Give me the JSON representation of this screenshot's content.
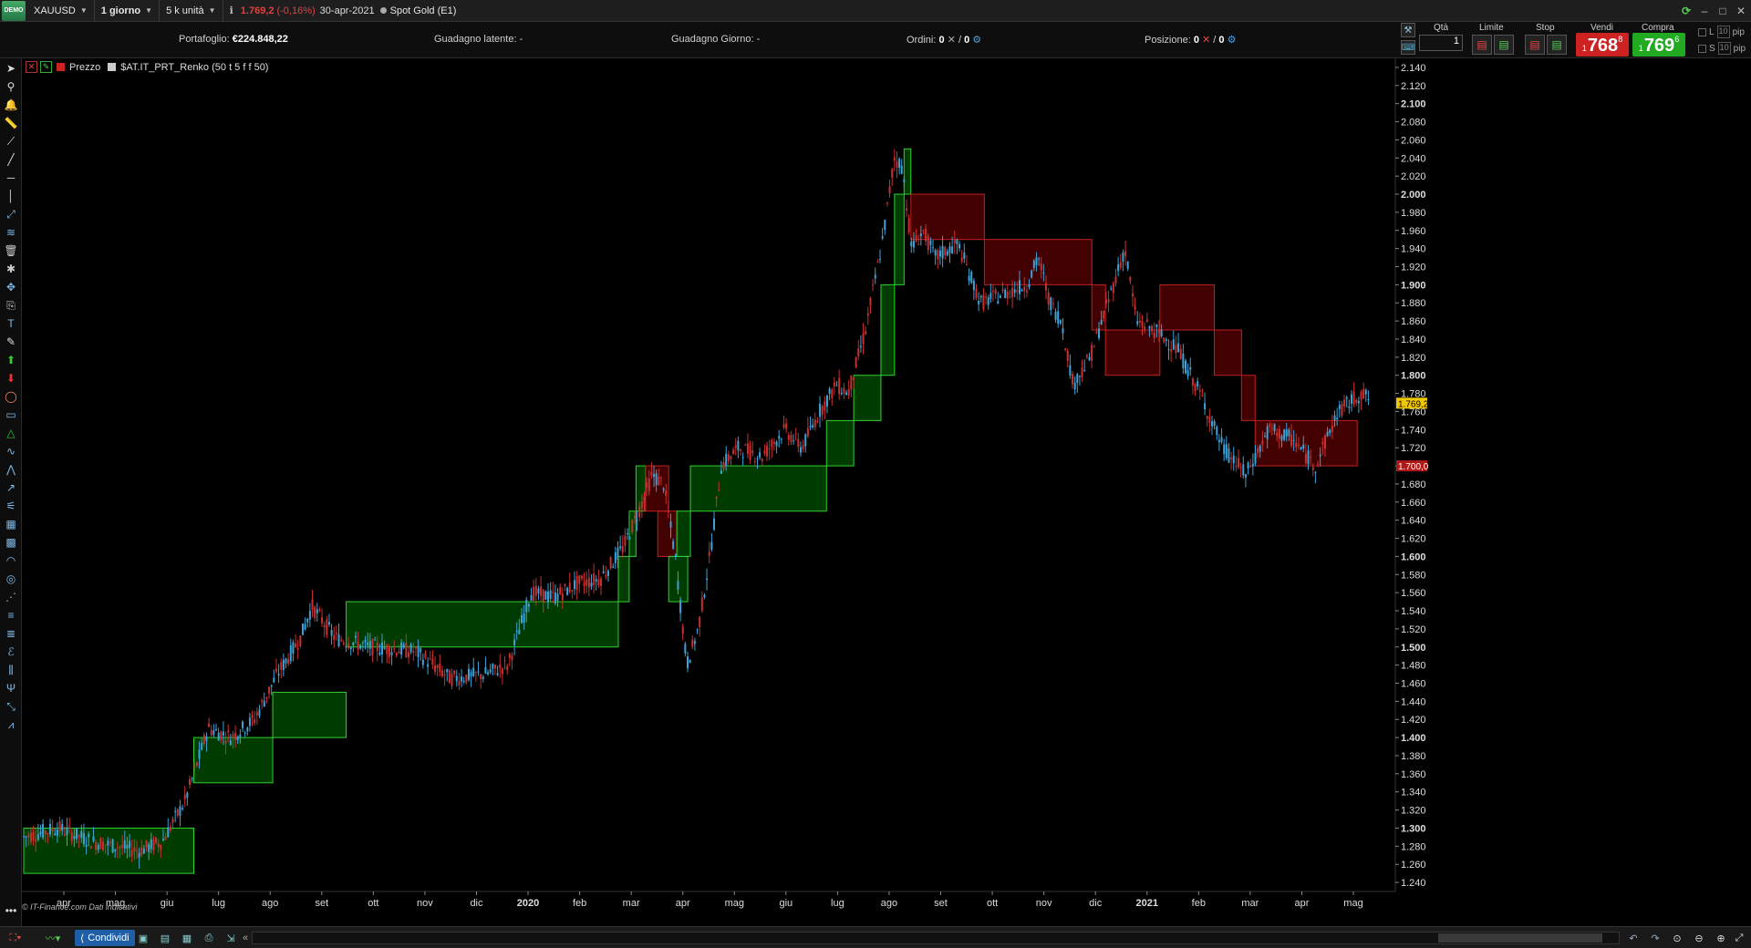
{
  "title_bar": {
    "badge": "DEMO",
    "symbol": "XAUUSD",
    "timeframe": "1 giorno",
    "units": "5 k unità",
    "last_price": "1.769,2",
    "change": "(-0,16%)",
    "date": "30-apr-2021",
    "instrument": "Spot Gold (E1)"
  },
  "account": {
    "portfolio_label": "Portafoglio:",
    "portfolio_value": "€224.848,22",
    "latent_label": "Guadagno latente:",
    "latent_value": "-",
    "day_label": "Guadagno Giorno:",
    "day_value": "-",
    "orders_label": "Ordini:",
    "orders_a": "0",
    "orders_sep": "/",
    "orders_b": "0",
    "position_label": "Posizione:",
    "position_a": "0",
    "position_sep": "/",
    "position_b": "0"
  },
  "order_panel": {
    "qty_label": "Qtà",
    "qty_value": "1",
    "limit_label": "Limite",
    "stop_label": "Stop",
    "sell_label": "Vendi",
    "buy_label": "Compra",
    "sell_prefix": "1",
    "sell_big": "768",
    "sell_sup": "8",
    "buy_prefix": "1",
    "buy_big": "769",
    "buy_sup": "6",
    "l_label": "L",
    "s_label": "S",
    "l_pip_value": "10",
    "s_pip_value": "10",
    "pip_label": "pip"
  },
  "legend": {
    "price_label": "Prezzo",
    "indicator_label": "$AT.IT_PRT_Renko (50 t 5 f f 50)"
  },
  "watermark": "© IT-Finance.com  Dati indicativi",
  "bottom_bar": {
    "share_label": "Condividi"
  },
  "chart_data": {
    "type": "candlestick",
    "instrument": "XAUUSD",
    "y_axis": {
      "range": [
        1230,
        2150
      ],
      "tick_labels": [
        "2.140",
        "2.120",
        "2.100",
        "2.080",
        "2.060",
        "2.040",
        "2.020",
        "2.000",
        "1.980",
        "1.960",
        "1.940",
        "1.920",
        "1.900",
        "1.880",
        "1.860",
        "1.840",
        "1.820",
        "1.800",
        "1.780",
        "1.760",
        "1.740",
        "1.720",
        "1.700",
        "1.680",
        "1.660",
        "1.640",
        "1.620",
        "1.600",
        "1.580",
        "1.560",
        "1.540",
        "1.520",
        "1.500",
        "1.480",
        "1.460",
        "1.440",
        "1.420",
        "1.400",
        "1.380",
        "1.360",
        "1.340",
        "1.320",
        "1.300",
        "1.280",
        "1.260",
        "1.240"
      ],
      "bold_labels": [
        "2.100",
        "2.000",
        "1.900",
        "1.800",
        "1.600",
        "1.500",
        "1.400",
        "1.300"
      ],
      "price_marker": "1.769,2",
      "secondary_marker": "1.700,0"
    },
    "x_axis": {
      "labels": [
        "apr",
        "mag",
        "giu",
        "lug",
        "ago",
        "set",
        "ott",
        "nov",
        "dic",
        "2020",
        "feb",
        "mar",
        "apr",
        "mag",
        "giu",
        "lug",
        "ago",
        "set",
        "ott",
        "nov",
        "dic",
        "2021",
        "feb",
        "mar",
        "apr",
        "mag"
      ],
      "bold_labels": [
        "2020",
        "2021"
      ]
    },
    "renko_bricks": [
      {
        "x0": 0.0,
        "x1": 0.125,
        "low": 1250,
        "high": 1300,
        "dir": "up"
      },
      {
        "x0": 0.0,
        "x1": 0.125,
        "low": 1300,
        "high": 1300,
        "dir": "up"
      },
      {
        "x0": 0.125,
        "x1": 0.183,
        "low": 1350,
        "high": 1400,
        "dir": "up"
      },
      {
        "x0": 0.183,
        "x1": 0.237,
        "low": 1400,
        "high": 1450,
        "dir": "up"
      },
      {
        "x0": 0.237,
        "x1": 0.437,
        "low": 1500,
        "high": 1550,
        "dir": "up"
      },
      {
        "x0": 0.437,
        "x1": 0.445,
        "low": 1550,
        "high": 1600,
        "dir": "up"
      },
      {
        "x0": 0.445,
        "x1": 0.45,
        "low": 1600,
        "high": 1650,
        "dir": "up"
      },
      {
        "x0": 0.45,
        "x1": 0.457,
        "low": 1650,
        "high": 1700,
        "dir": "up"
      },
      {
        "x0": 0.457,
        "x1": 0.474,
        "low": 1650,
        "high": 1700,
        "dir": "down"
      },
      {
        "x0": 0.466,
        "x1": 0.48,
        "low": 1600,
        "high": 1650,
        "dir": "down"
      },
      {
        "x0": 0.474,
        "x1": 0.488,
        "low": 1550,
        "high": 1600,
        "dir": "up"
      },
      {
        "x0": 0.48,
        "x1": 0.49,
        "low": 1600,
        "high": 1650,
        "dir": "up"
      },
      {
        "x0": 0.49,
        "x1": 0.59,
        "low": 1650,
        "high": 1700,
        "dir": "up"
      },
      {
        "x0": 0.59,
        "x1": 0.61,
        "low": 1700,
        "high": 1750,
        "dir": "up"
      },
      {
        "x0": 0.61,
        "x1": 0.63,
        "low": 1750,
        "high": 1800,
        "dir": "up"
      },
      {
        "x0": 0.63,
        "x1": 0.64,
        "low": 1800,
        "high": 1900,
        "dir": "up"
      },
      {
        "x0": 0.64,
        "x1": 0.647,
        "low": 1900,
        "high": 2000,
        "dir": "up"
      },
      {
        "x0": 0.647,
        "x1": 0.652,
        "low": 2000,
        "high": 2050,
        "dir": "up"
      },
      {
        "x0": 0.652,
        "x1": 0.706,
        "low": 1950,
        "high": 2000,
        "dir": "down"
      },
      {
        "x0": 0.706,
        "x1": 0.785,
        "low": 1900,
        "high": 1950,
        "dir": "down"
      },
      {
        "x0": 0.785,
        "x1": 0.795,
        "low": 1850,
        "high": 1900,
        "dir": "down"
      },
      {
        "x0": 0.795,
        "x1": 0.835,
        "low": 1800,
        "high": 1850,
        "dir": "down"
      },
      {
        "x0": 0.835,
        "x1": 0.875,
        "low": 1850,
        "high": 1900,
        "dir": "down"
      },
      {
        "x0": 0.875,
        "x1": 0.895,
        "low": 1800,
        "high": 1850,
        "dir": "down"
      },
      {
        "x0": 0.895,
        "x1": 0.905,
        "low": 1750,
        "high": 1800,
        "dir": "down"
      },
      {
        "x0": 0.905,
        "x1": 0.98,
        "low": 1700,
        "high": 1750,
        "dir": "down"
      }
    ]
  }
}
